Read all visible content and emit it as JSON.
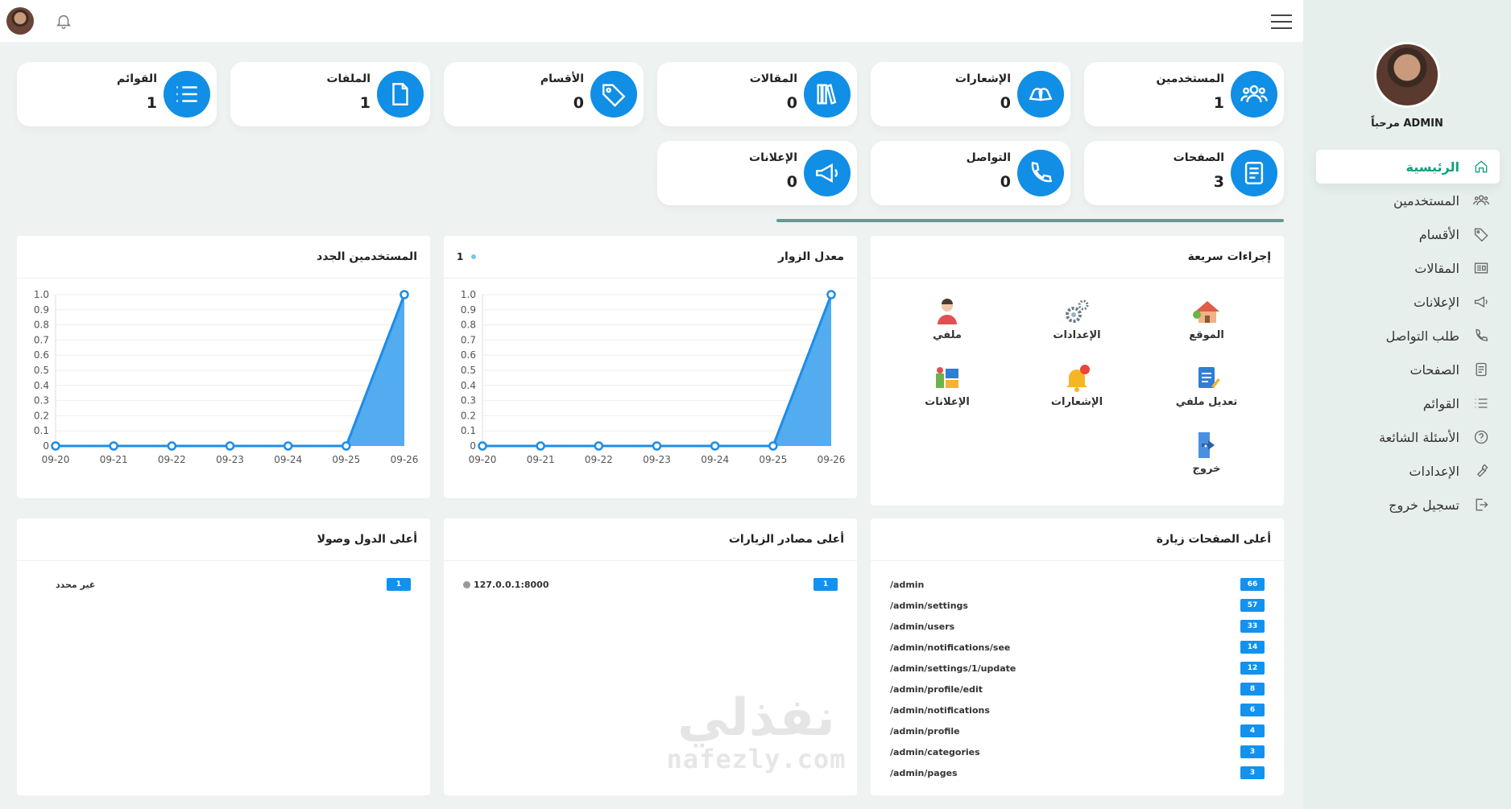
{
  "sidebar": {
    "welcome": "مرحباً ADMIN",
    "items": [
      {
        "label": "الرئيسية",
        "icon": "home-icon",
        "active": true
      },
      {
        "label": "المستخدمين",
        "icon": "users-icon"
      },
      {
        "label": "الأقسام",
        "icon": "tag-icon"
      },
      {
        "label": "المقالات",
        "icon": "newspaper-icon"
      },
      {
        "label": "الإعلانات",
        "icon": "megaphone-icon"
      },
      {
        "label": "طلب التواصل",
        "icon": "phone-icon"
      },
      {
        "label": "الصفحات",
        "icon": "document-icon"
      },
      {
        "label": "القوائم",
        "icon": "list-icon"
      },
      {
        "label": "الأسئلة الشائعة",
        "icon": "question-icon"
      },
      {
        "label": "الإعدادات",
        "icon": "wrench-icon"
      },
      {
        "label": "تسجيل خروج",
        "icon": "logout-icon"
      }
    ]
  },
  "stats": [
    {
      "label": "المستخدمين",
      "value": "1",
      "icon": "users-icon"
    },
    {
      "label": "الإشعارات",
      "value": "0",
      "icon": "bells-icon"
    },
    {
      "label": "المقالات",
      "value": "0",
      "icon": "books-icon"
    },
    {
      "label": "الأقسام",
      "value": "0",
      "icon": "tag-icon"
    },
    {
      "label": "الملفات",
      "value": "1",
      "icon": "file-icon"
    },
    {
      "label": "القوائم",
      "value": "1",
      "icon": "list-icon"
    },
    {
      "label": "الصفحات",
      "value": "3",
      "icon": "document-icon"
    },
    {
      "label": "التواصل",
      "value": "0",
      "icon": "phone-icon"
    },
    {
      "label": "الإعلانات",
      "value": "0",
      "icon": "megaphone-icon"
    }
  ],
  "quick_actions": {
    "title": "إجراءات سريعة",
    "items": [
      {
        "label": "الموقع",
        "icon": "house-icon"
      },
      {
        "label": "الإعدادات",
        "icon": "gears-icon"
      },
      {
        "label": "ملفي",
        "icon": "person-icon"
      },
      {
        "label": "تعديل ملفي",
        "icon": "edit-document-icon"
      },
      {
        "label": "الإشعارات",
        "icon": "bell-alert-icon"
      },
      {
        "label": "الإعلانات",
        "icon": "ads-icon"
      },
      {
        "label": "خروج",
        "icon": "exit-door-icon"
      }
    ]
  },
  "visitors_panel": {
    "title": "معدل الزوار",
    "legend_value": "1"
  },
  "new_users_panel": {
    "title": "المستخدمين الجدد"
  },
  "chart_data": [
    {
      "type": "area",
      "x": [
        "09-20",
        "09-21",
        "09-22",
        "09-23",
        "09-24",
        "09-25",
        "09-26"
      ],
      "series": [
        {
          "name": "1",
          "values": [
            0,
            0,
            0,
            0,
            0,
            0,
            1
          ]
        }
      ],
      "yticks": [
        "0",
        "0.1",
        "0.2",
        "0.3",
        "0.4",
        "0.5",
        "0.6",
        "0.7",
        "0.8",
        "0.9",
        "1.0"
      ],
      "ylim": [
        0,
        1
      ],
      "color": "#1d8de6"
    },
    {
      "type": "area",
      "x": [
        "09-20",
        "09-21",
        "09-22",
        "09-23",
        "09-24",
        "09-25",
        "09-26"
      ],
      "series": [
        {
          "values": [
            0,
            0,
            0,
            0,
            0,
            0,
            1
          ]
        }
      ],
      "yticks": [
        "0",
        "0.1",
        "0.2",
        "0.3",
        "0.4",
        "0.5",
        "0.6",
        "0.7",
        "0.8",
        "0.9",
        "1.0"
      ],
      "ylim": [
        0,
        1
      ],
      "color": "#1d8de6"
    }
  ],
  "top_pages": {
    "title": "أعلى الصفحات زيارة",
    "rows": [
      {
        "path": "/admin",
        "count": "66"
      },
      {
        "path": "/admin/settings",
        "count": "57"
      },
      {
        "path": "/admin/users",
        "count": "33"
      },
      {
        "path": "/admin/notifications/see",
        "count": "14"
      },
      {
        "path": "/admin/settings/1/update",
        "count": "12"
      },
      {
        "path": "/admin/profile/edit",
        "count": "8"
      },
      {
        "path": "/admin/notifications",
        "count": "6"
      },
      {
        "path": "/admin/profile",
        "count": "4"
      },
      {
        "path": "/admin/categories",
        "count": "3"
      },
      {
        "path": "/admin/pages",
        "count": "3"
      }
    ]
  },
  "top_sources": {
    "title": "أعلى مصادر الزيارات",
    "rows": [
      {
        "source": "127.0.0.1:8000",
        "count": "1"
      }
    ]
  },
  "top_countries": {
    "title": "أعلى الدول وصولا",
    "rows": [
      {
        "country": "غير محدد",
        "count": "1"
      }
    ]
  },
  "watermark": {
    "arabic": "نفذلي",
    "latin": "nafezly.com"
  },
  "colors": {
    "primary": "#118ee6",
    "accent": "#12a07d",
    "divider": "#5e9c95"
  }
}
